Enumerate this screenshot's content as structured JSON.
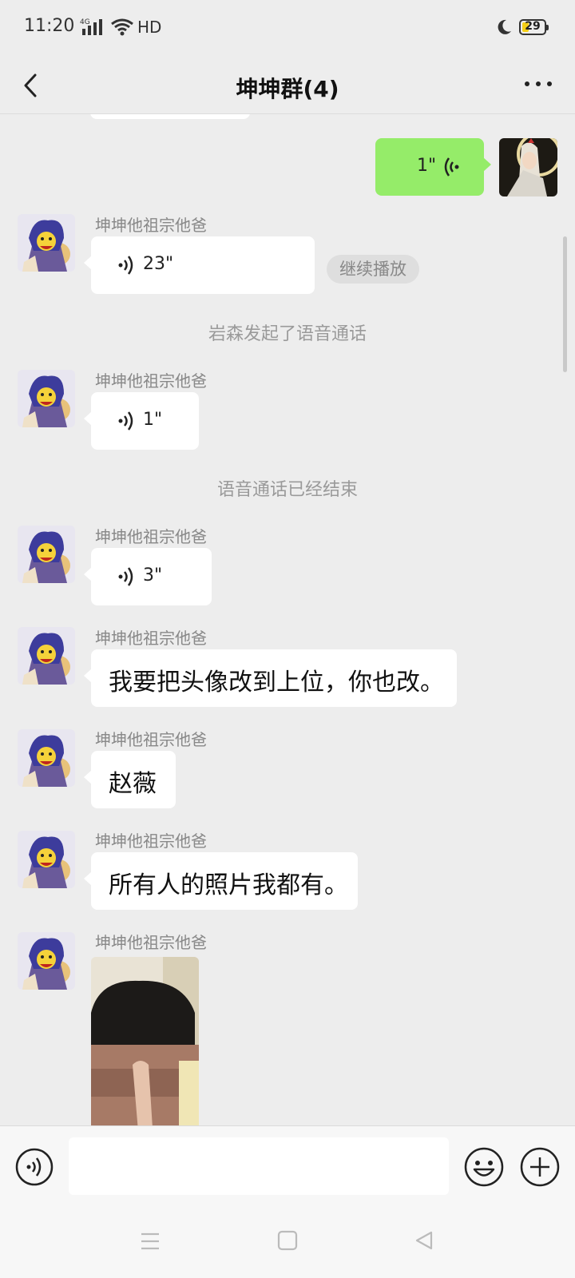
{
  "status_bar": {
    "time": "11:20",
    "network": "4G",
    "hd": "HD",
    "battery": "29"
  },
  "header": {
    "title": "坤坤群(4)"
  },
  "messages": {
    "sent_voice_duration": "1\"",
    "m1": {
      "sender": "坤坤他祖宗他爸",
      "duration": "23\"",
      "continue_label": "继续播放"
    },
    "system1": "岩森发起了语音通话",
    "m2": {
      "sender": "坤坤他祖宗他爸",
      "duration": "1\""
    },
    "system2": "语音通话已经结束",
    "m3": {
      "sender": "坤坤他祖宗他爸",
      "duration": "3\""
    },
    "m4": {
      "sender": "坤坤他祖宗他爸",
      "text": "我要把头像改到上位，你也改。"
    },
    "m5": {
      "sender": "坤坤他祖宗他爸",
      "text": "赵薇"
    },
    "m6": {
      "sender": "坤坤他祖宗他爸",
      "text": "所有人的照片我都有。"
    },
    "m7": {
      "sender": "坤坤他祖宗他爸"
    }
  },
  "input": {
    "placeholder": ""
  },
  "colors": {
    "background": "#ededed",
    "sent_bubble": "#95ec69",
    "received_bubble": "#ffffff"
  },
  "icons": [
    "back-icon",
    "more-icon",
    "voice-wave-icon",
    "voice-toggle-icon",
    "emoji-icon",
    "plus-icon",
    "menu-icon",
    "home-icon",
    "back-triangle-icon"
  ]
}
